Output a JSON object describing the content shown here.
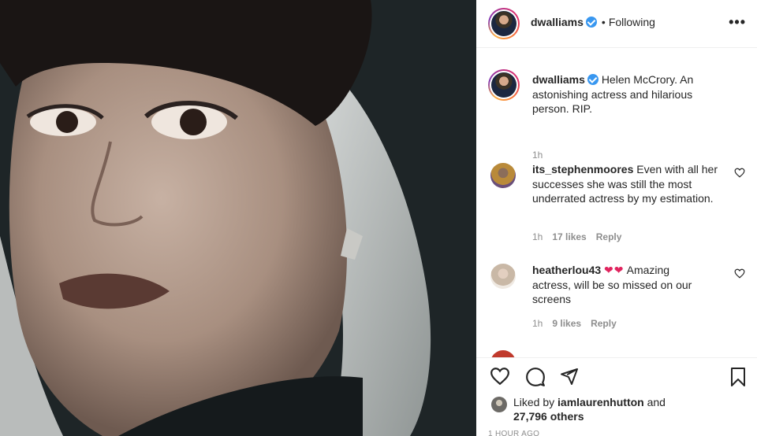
{
  "post": {
    "username": "dwalliams",
    "follow_status": "Following",
    "more_label": "•••"
  },
  "caption": {
    "username": "dwalliams",
    "text": "Helen McCrory. An astonishing actress and hilarious person. RIP.",
    "time": "1h"
  },
  "comments": [
    {
      "username": "its_stephenmoores",
      "text": "Even with all her successes she was still the most underrated actress by my estimation.",
      "time": "1h",
      "likes": "17 likes",
      "reply": "Reply"
    },
    {
      "username": "heatherlou43",
      "emoji": "❤❤",
      "text": "Amazing actress, will be so missed on our screens",
      "time": "1h",
      "likes": "9 likes",
      "reply": "Reply"
    }
  ],
  "likes": {
    "prefix": "Liked by",
    "user": "iamlaurenhutton",
    "conjunction": "and",
    "others": "27,796 others"
  },
  "timestamp": "1 HOUR AGO",
  "colors": {
    "verified": "#3897f0",
    "heart": "#e0245e",
    "meta": "#8e8e8e"
  }
}
